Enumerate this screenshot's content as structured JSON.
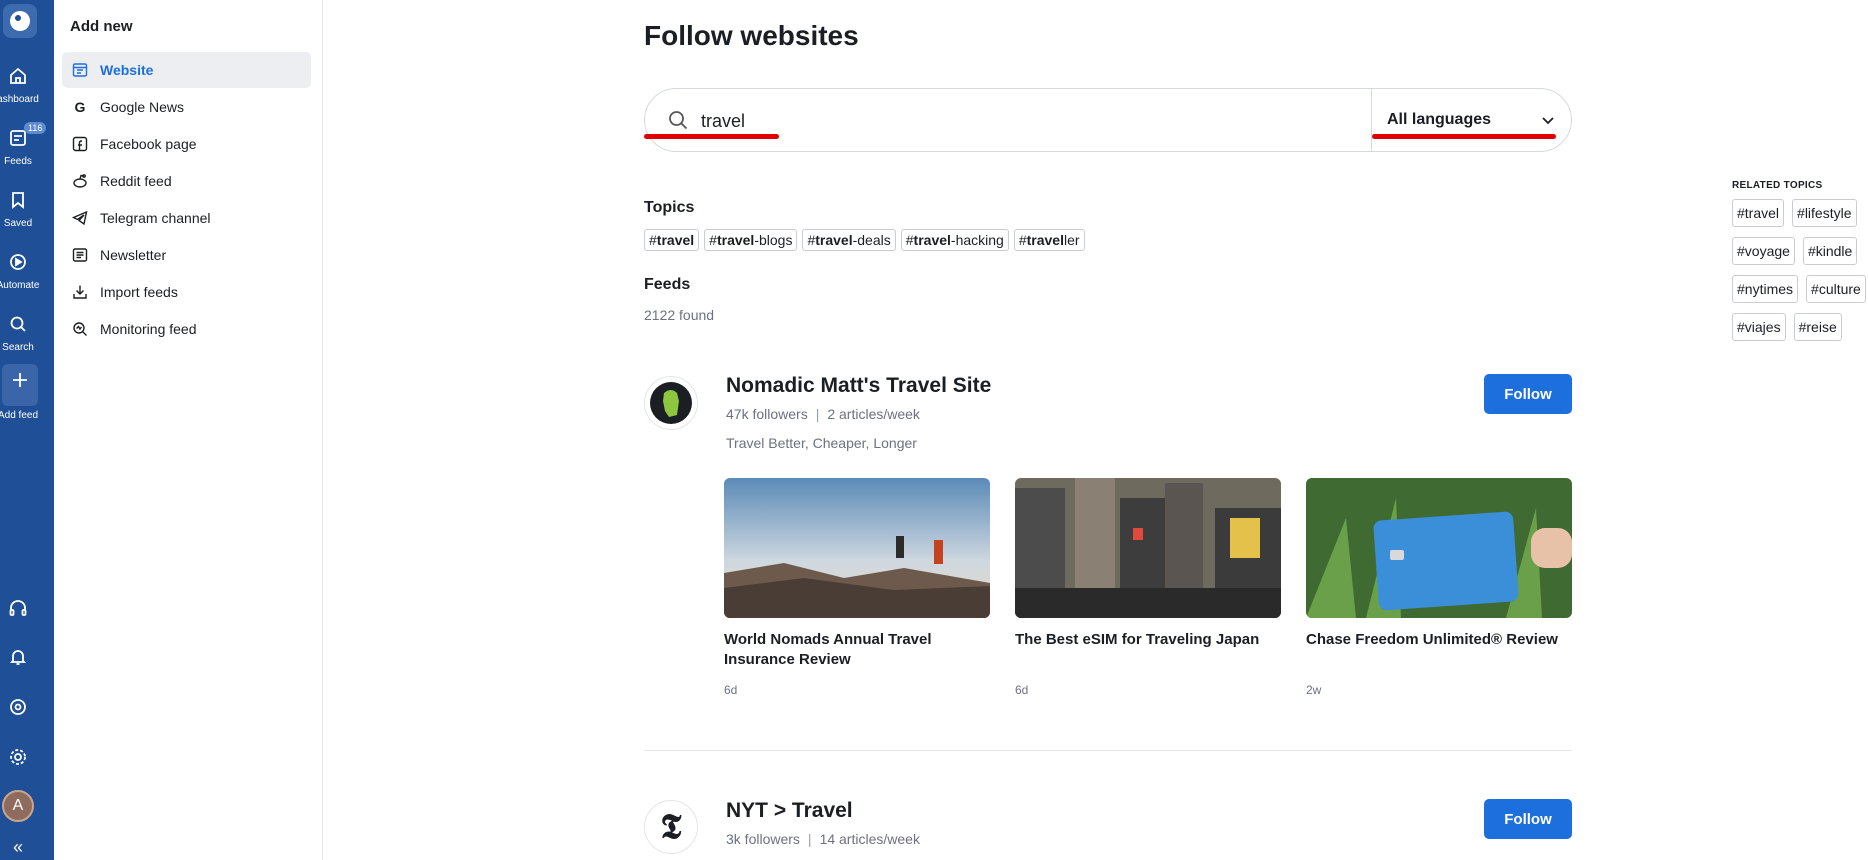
{
  "rail": {
    "items": [
      {
        "label": "ashboard",
        "icon": "home-icon"
      },
      {
        "label": "Feeds",
        "icon": "feeds-icon",
        "badge": "116"
      },
      {
        "label": "Saved",
        "icon": "bookmark-icon"
      },
      {
        "label": "Automate",
        "icon": "automate-icon"
      },
      {
        "label": "Search",
        "icon": "search-icon"
      },
      {
        "label": "Add feed",
        "icon": "plus-icon"
      }
    ],
    "avatar_initial": "A",
    "collapse_glyph": "«"
  },
  "panel": {
    "title": "Add new",
    "items": [
      {
        "label": "Website",
        "icon": "website-icon",
        "active": true
      },
      {
        "label": "Google News",
        "icon": "google-icon"
      },
      {
        "label": "Facebook page",
        "icon": "facebook-icon"
      },
      {
        "label": "Reddit feed",
        "icon": "reddit-icon"
      },
      {
        "label": "Telegram channel",
        "icon": "telegram-icon"
      },
      {
        "label": "Newsletter",
        "icon": "newsletter-icon"
      },
      {
        "label": "Import feeds",
        "icon": "import-icon"
      },
      {
        "label": "Monitoring feed",
        "icon": "monitoring-icon"
      }
    ]
  },
  "main": {
    "title": "Follow websites",
    "search": {
      "value": "travel",
      "placeholder": ""
    },
    "language": "All languages",
    "topics_title": "Topics",
    "topics": [
      {
        "bold": "travel",
        "rest": ""
      },
      {
        "bold": "travel",
        "rest": "-blogs"
      },
      {
        "bold": "travel",
        "rest": "-deals"
      },
      {
        "bold": "travel",
        "rest": "-hacking"
      },
      {
        "bold": "travel",
        "rest": "ler"
      }
    ],
    "feeds_title": "Feeds",
    "found": "2122 found",
    "feeds": [
      {
        "name": "Nomadic Matt's Travel Site",
        "followers": "47k followers",
        "rate": "2 articles/week",
        "description": "Travel Better, Cheaper, Longer",
        "follow_label": "Follow",
        "articles": [
          {
            "title": "World Nomads Annual Travel Insurance Review",
            "age": "6d"
          },
          {
            "title": "The Best eSIM for Traveling Japan",
            "age": "6d"
          },
          {
            "title": "Chase Freedom Unlimited® Review",
            "age": "2w"
          }
        ]
      },
      {
        "name": "NYT > Travel",
        "followers": "3k followers",
        "rate": "14 articles/week",
        "follow_label": "Follow"
      }
    ]
  },
  "related": {
    "title": "RELATED TOPICS",
    "topics": [
      "#travel",
      "#lifestyle",
      "#voyage",
      "#kindle",
      "#nytimes",
      "#culture",
      "#viajes",
      "#reise"
    ]
  },
  "colors": {
    "accent": "#1c6fdc",
    "rail": "#1f4f96",
    "annotation": "#e00000"
  }
}
